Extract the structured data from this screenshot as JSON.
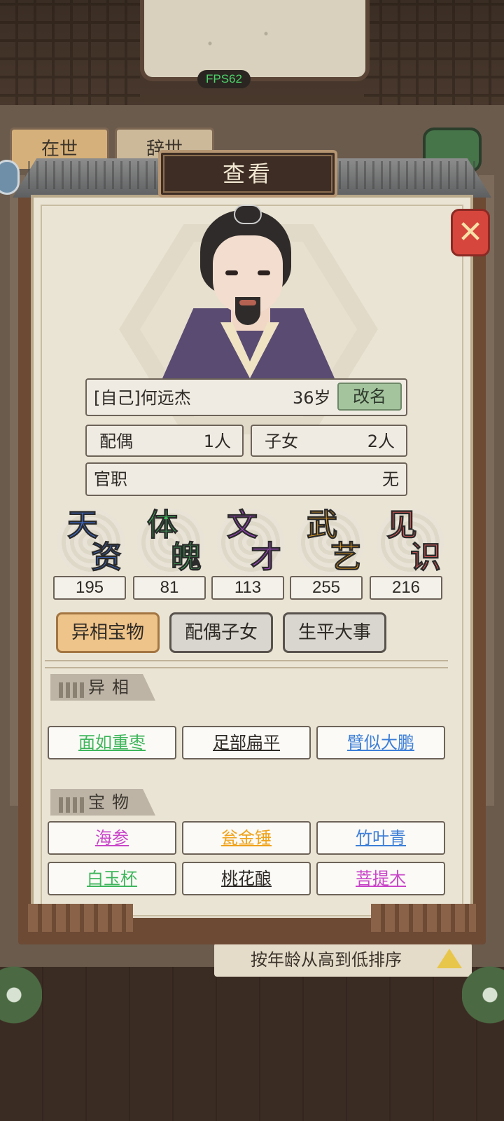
{
  "status": {
    "fps": "FPS62"
  },
  "background": {
    "tabs": [
      "在世",
      "辞世"
    ],
    "sort_label": "按年龄从高到低排序"
  },
  "dialog": {
    "title": "查看",
    "character": {
      "name": "[自己]何远杰",
      "age": "36岁",
      "rename_label": "改名",
      "spouse_label": "配偶",
      "spouse_value": "1人",
      "children_label": "子女",
      "children_value": "2人",
      "office_label": "官职",
      "office_value": "无"
    },
    "attributes": [
      {
        "name": "天资",
        "value": "195",
        "color": "#3d6fd8"
      },
      {
        "name": "体魄",
        "value": "81",
        "color": "#3fb65c"
      },
      {
        "name": "文才",
        "value": "113",
        "color": "#a545c9"
      },
      {
        "name": "武艺",
        "value": "255",
        "color": "#f0a21a"
      },
      {
        "name": "见识",
        "value": "216",
        "color": "#e25a58"
      }
    ],
    "tabs": [
      {
        "label": "异相宝物",
        "active": true
      },
      {
        "label": "配偶子女",
        "active": false
      },
      {
        "label": "生平大事",
        "active": false
      }
    ],
    "sections": {
      "traits_title": "异相",
      "traits": [
        {
          "label": "面如重枣",
          "color": "#3fb65c"
        },
        {
          "label": "足部扁平",
          "color": "#2e2a26"
        },
        {
          "label": "臂似大鹏",
          "color": "#3d7fd8"
        }
      ],
      "treasures_title": "宝物",
      "treasures": [
        {
          "label": "海参",
          "color": "#c945c9"
        },
        {
          "label": "瓮金锤",
          "color": "#f0a21a"
        },
        {
          "label": "竹叶青",
          "color": "#3d7fd8"
        },
        {
          "label": "白玉杯",
          "color": "#3fb65c"
        },
        {
          "label": "桃花酿",
          "color": "#2e2a26"
        },
        {
          "label": "菩提木",
          "color": "#c945c9"
        }
      ]
    }
  }
}
